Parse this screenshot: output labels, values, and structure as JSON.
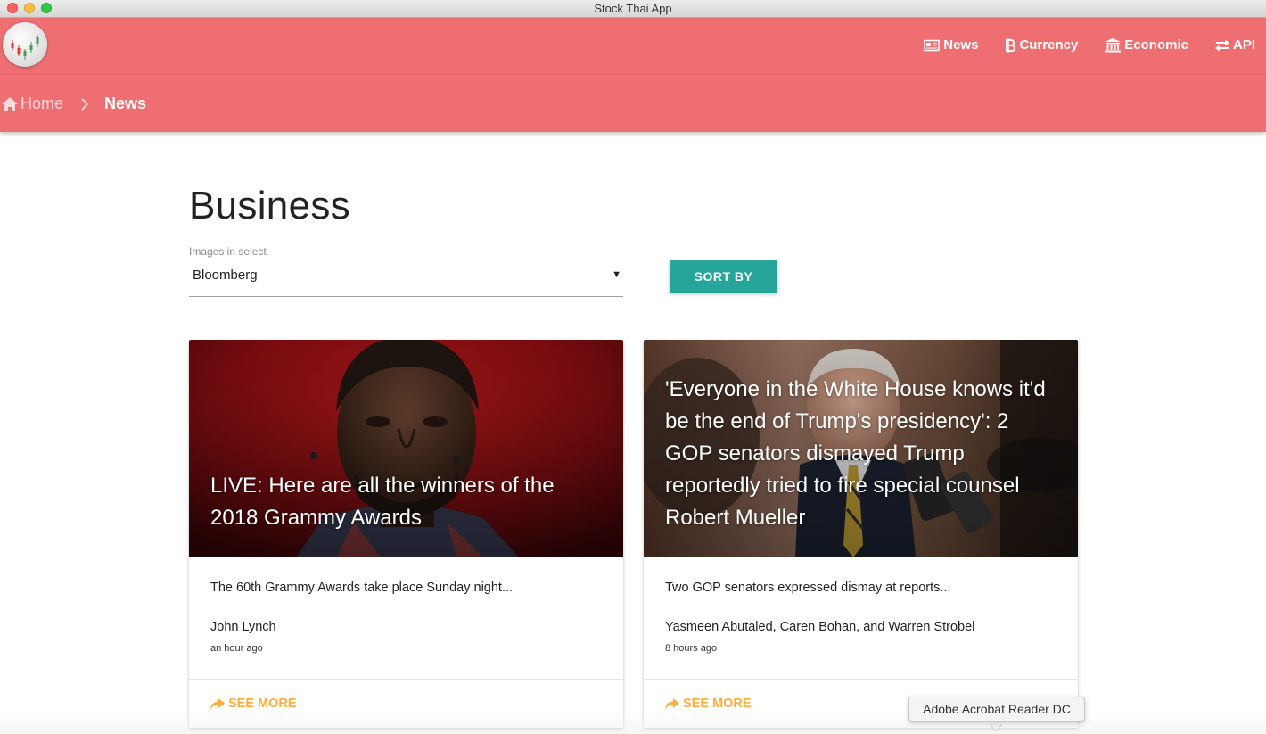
{
  "window": {
    "title": "Stock Thai App"
  },
  "nav": {
    "items": [
      {
        "label": "News",
        "icon": "newspaper-icon"
      },
      {
        "label": "Currency",
        "icon": "bitcoin-icon"
      },
      {
        "label": "Economic",
        "icon": "bank-icon"
      },
      {
        "label": "API",
        "icon": "exchange-icon"
      }
    ]
  },
  "breadcrumb": {
    "home": "Home",
    "current": "News"
  },
  "main": {
    "title": "Business",
    "select": {
      "label": "Images in select",
      "value": "Bloomberg"
    },
    "sort_label": "SORT BY"
  },
  "cards": [
    {
      "title": "LIVE: Here are all the winners of the 2018 Grammy Awards",
      "description": "The 60th Grammy Awards take place Sunday night...",
      "author": "John Lynch",
      "time": "an hour ago",
      "action": "SEE MORE"
    },
    {
      "title": "'Everyone in the White House knows it'd be the end of Trump's presidency': 2 GOP senators dismayed Trump reportedly tried to fire special counsel Robert Mueller",
      "description": "Two GOP senators expressed dismay at reports...",
      "author": "Yasmeen Abutaled, Caren Bohan, and Warren Strobel",
      "time": "8 hours ago",
      "action": "SEE MORE"
    }
  ],
  "tooltip": {
    "text": "Adobe Acrobat Reader DC"
  },
  "colors": {
    "appbar": "#ef6e72",
    "sort_button": "#26a69a",
    "see_more": "#ffab40"
  }
}
